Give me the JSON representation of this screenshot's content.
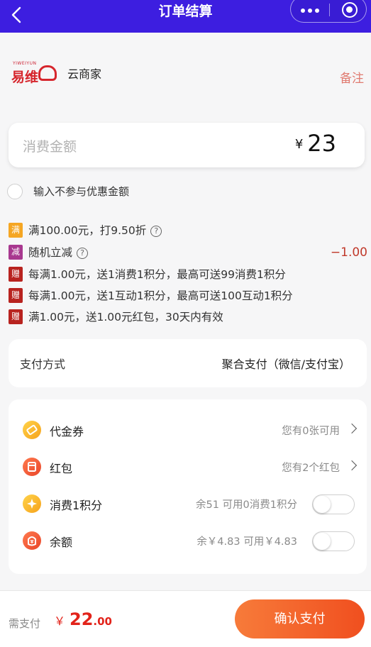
{
  "header": {
    "title": "订单结算"
  },
  "store": {
    "logo_small": "YIWEIYUN",
    "logo_text": "易维",
    "name": "云商家",
    "remark_label": "备注"
  },
  "amount": {
    "label": "消费金额",
    "currency": "¥",
    "value": "23"
  },
  "exclude_discount": {
    "label": "输入不参与优惠金额",
    "checked": false
  },
  "promotions": [
    {
      "tag": "满",
      "text": "满100.00元，打9.50折",
      "help": "?",
      "amount": ""
    },
    {
      "tag": "减",
      "text": "随机立减",
      "help": "?",
      "amount": "−1.00"
    },
    {
      "tag": "赠",
      "text": "每满1.00元，送1消费1积分，最高可送99消费1积分",
      "help": "",
      "amount": ""
    },
    {
      "tag": "赠",
      "text": "每满1.00元，送1互动1积分，最高可送100互动1积分",
      "help": "",
      "amount": ""
    },
    {
      "tag": "赠",
      "text": "满1.00元，送1.00元红包，30天内有效",
      "help": "",
      "amount": ""
    }
  ],
  "payment": {
    "label": "支付方式",
    "value": "聚合支付（微信/支付宝）"
  },
  "assets": [
    {
      "icon": "voucher-icon",
      "label": "代金券",
      "note": "您有0张可用",
      "control": "chevron"
    },
    {
      "icon": "red-packet-icon",
      "label": "红包",
      "note": "您有2个红包",
      "control": "chevron"
    },
    {
      "icon": "points-icon",
      "label": "消费1积分",
      "note": "余51 可用0消费1积分",
      "control": "toggle",
      "enabled": false
    },
    {
      "icon": "balance-icon",
      "label": "余额",
      "note": "余￥4.83 可用￥4.83",
      "control": "toggle",
      "enabled": false
    }
  ],
  "footer": {
    "need_label": "需支付",
    "currency": "￥",
    "total_int": "22",
    "total_dec": ".00",
    "confirm_label": "确认支付"
  },
  "colors": {
    "header_bg": "#3d1ee0",
    "accent_red": "#e2231a",
    "confirm_gradient_start": "#f77b3a",
    "confirm_gradient_end": "#f04f1f"
  }
}
